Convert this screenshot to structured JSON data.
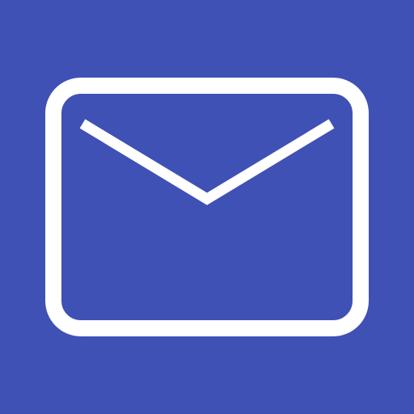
{
  "icon": {
    "name": "mail-icon",
    "background_color": "#3f51b5",
    "foreground_color": "#ffffff"
  }
}
